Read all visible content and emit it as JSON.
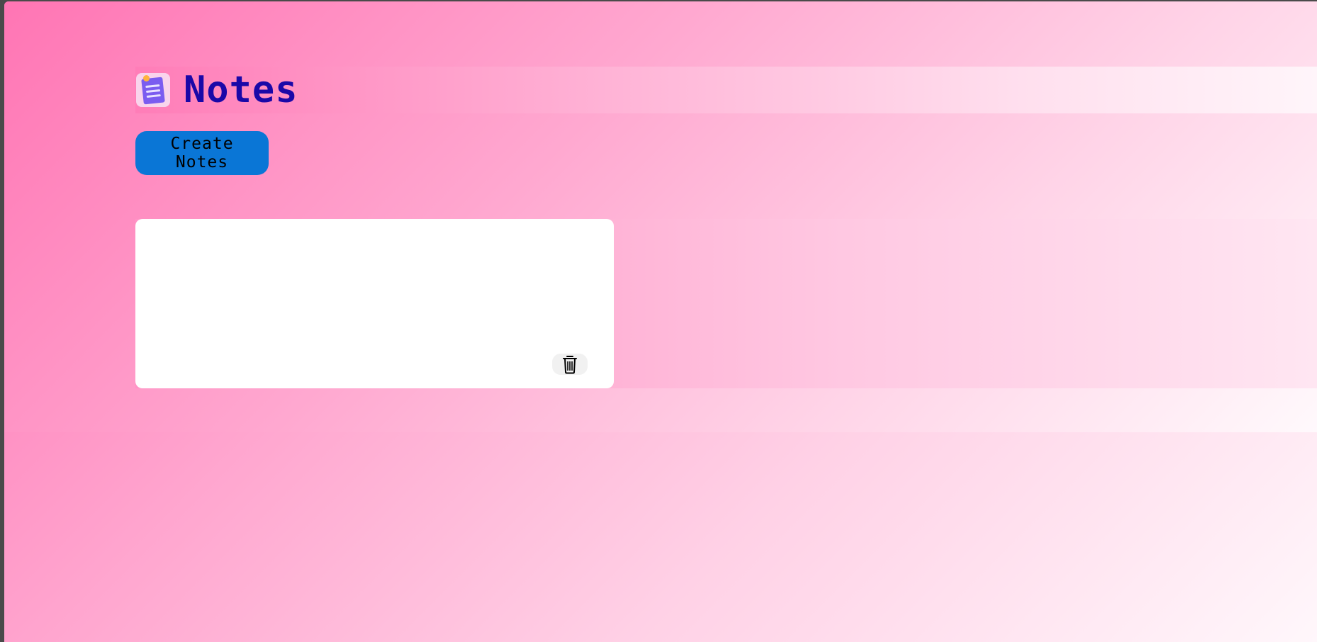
{
  "app": {
    "title": "Notes"
  },
  "toolbar": {
    "create_label": "Create Notes"
  },
  "notes": [
    {
      "content": "",
      "delete_icon": "trash-icon"
    }
  ],
  "colors": {
    "title": "#1a08a8",
    "create_button": "#0a76d6",
    "background_start": "#ff6fb1",
    "background_end": "#fff7fb",
    "note_card": "#ffffff"
  }
}
